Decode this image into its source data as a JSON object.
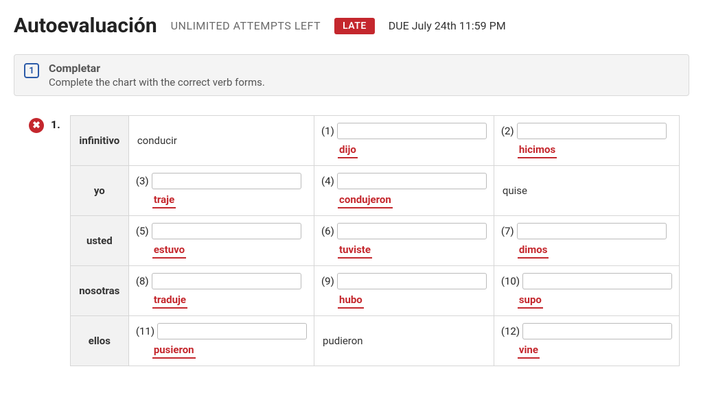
{
  "header": {
    "title": "Autoevaluación",
    "attempts": "UNLIMITED ATTEMPTS LEFT",
    "late": "LATE",
    "due": "DUE  July 24th 11:59 PM"
  },
  "instructions": {
    "step": "1",
    "title": "Completar",
    "sub": "Complete the chart with the correct verb forms."
  },
  "question": {
    "number": "1.",
    "rows": [
      "infinitivo",
      "yo",
      "usted",
      "nosotras",
      "ellos"
    ]
  },
  "chart_data": {
    "type": "table",
    "title": "Verb conjugation chart",
    "rows": [
      {
        "label": "infinitivo",
        "cells": [
          {
            "kind": "static",
            "value": "conducir"
          },
          {
            "kind": "blank",
            "num": "(1)",
            "answer": "dijo"
          },
          {
            "kind": "blank",
            "num": "(2)",
            "answer": "hicimos"
          }
        ]
      },
      {
        "label": "yo",
        "cells": [
          {
            "kind": "blank",
            "num": "(3)",
            "answer": "traje"
          },
          {
            "kind": "blank",
            "num": "(4)",
            "answer": "condujeron"
          },
          {
            "kind": "static",
            "value": "quise"
          }
        ]
      },
      {
        "label": "usted",
        "cells": [
          {
            "kind": "blank",
            "num": "(5)",
            "answer": "estuvo"
          },
          {
            "kind": "blank",
            "num": "(6)",
            "answer": "tuviste"
          },
          {
            "kind": "blank",
            "num": "(7)",
            "answer": "dimos"
          }
        ]
      },
      {
        "label": "nosotras",
        "cells": [
          {
            "kind": "blank",
            "num": "(8)",
            "answer": "traduje"
          },
          {
            "kind": "blank",
            "num": "(9)",
            "answer": "hubo"
          },
          {
            "kind": "blank",
            "num": "(10)",
            "answer": "supo"
          }
        ]
      },
      {
        "label": "ellos",
        "cells": [
          {
            "kind": "blank",
            "num": "(11)",
            "answer": "pusieron"
          },
          {
            "kind": "static",
            "value": "pudieron"
          },
          {
            "kind": "blank",
            "num": "(12)",
            "answer": "vine"
          }
        ]
      }
    ]
  }
}
